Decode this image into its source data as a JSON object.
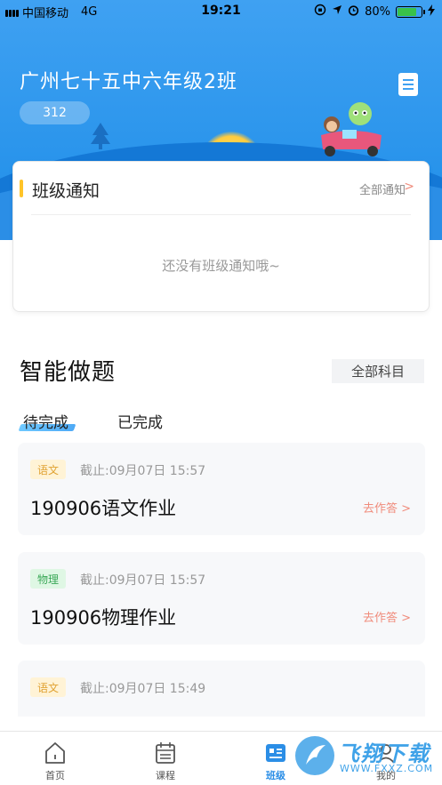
{
  "status_bar": {
    "carrier": "中国移动",
    "network": "4G",
    "time": "19:21",
    "battery": "80%",
    "battery_level": 0.8
  },
  "header": {
    "class_name": "广州七十五中六年级2班",
    "class_code": "312"
  },
  "notice": {
    "title": "班级通知",
    "more_label": "全部通知",
    "more_arrow": ">",
    "empty_text": "还没有班级通知哦~"
  },
  "homework": {
    "title": "智能做题",
    "subject_filter": "全部科目",
    "tabs": {
      "pending": "待完成",
      "done": "已完成"
    },
    "tasks": [
      {
        "subject": "语文",
        "deadline": "截止:09月07日 15:57",
        "name": "190906语文作业",
        "action": "去作答 >"
      },
      {
        "subject": "物理",
        "deadline": "截止:09月07日 15:57",
        "name": "190906物理作业",
        "action": "去作答 >"
      },
      {
        "subject": "语文",
        "deadline": "截止:09月07日 15:49",
        "name": "",
        "action": ""
      }
    ]
  },
  "tabbar": {
    "items": [
      {
        "label": "首页"
      },
      {
        "label": "课程"
      },
      {
        "label": "班级"
      },
      {
        "label": "我的"
      }
    ]
  },
  "watermark": {
    "text": "飞翔下载",
    "url": "WWW.FXXZ.COM"
  },
  "colors": {
    "header_blue": "#3fa1f2",
    "accent_blue": "#2b8ee6",
    "notice_bar": "#ffc428",
    "action": "#f08c7c"
  }
}
